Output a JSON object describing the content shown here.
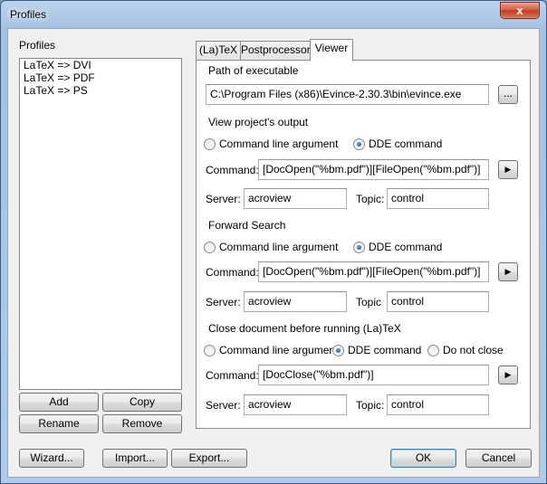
{
  "window": {
    "title": "Profiles",
    "close_glyph": "x"
  },
  "profiles": {
    "label": "Profiles",
    "items": [
      "LaTeX => DVI",
      "LaTeX => PDF",
      "LaTeX => PS"
    ],
    "buttons": {
      "add": "Add",
      "copy": "Copy",
      "rename": "Rename",
      "remove": "Remove"
    }
  },
  "tabs": [
    {
      "label": "(La)TeX"
    },
    {
      "label": "Postprocessor"
    },
    {
      "label": "Viewer",
      "active": true
    }
  ],
  "viewer": {
    "path": {
      "group_label": "Path of executable",
      "value": "C:\\Program Files (x86)\\Evince-2.30.3\\bin\\evince.exe",
      "browse_label": "..."
    },
    "view_output": {
      "group_label": "View project's output",
      "radio_cmd": "Command line argument",
      "radio_dde": "DDE command",
      "selected": "dde",
      "command_label": "Command:",
      "command_value": "[DocOpen(\"%bm.pdf\")][FileOpen(\"%bm.pdf\")]",
      "server_label": "Server:",
      "server_value": "acroview",
      "topic_label": "Topic:",
      "topic_value": "control"
    },
    "forward_search": {
      "group_label": "Forward Search",
      "radio_cmd": "Command line argument",
      "radio_dde": "DDE command",
      "selected": "dde",
      "command_label": "Command:",
      "command_value": "[DocOpen(\"%bm.pdf\")][FileOpen(\"%bm.pdf\")]",
      "server_label": "Server:",
      "server_value": "acroview",
      "topic_label": "Topic",
      "topic_value": "control"
    },
    "close_doc": {
      "group_label": "Close document before running (La)TeX",
      "radio_cmd": "Command line argument",
      "radio_dde": "DDE command",
      "radio_none": "Do not close",
      "selected": "dde",
      "command_label": "Command:",
      "command_value": "[DocClose(\"%bm.pdf\")]",
      "server_label": "Server:",
      "server_value": "acroview",
      "topic_label": "Topic:",
      "topic_value": "control"
    },
    "arrow_glyph": "▶"
  },
  "footer": {
    "wizard": "Wizard...",
    "import": "Import...",
    "export": "Export...",
    "ok": "OK",
    "cancel": "Cancel"
  }
}
